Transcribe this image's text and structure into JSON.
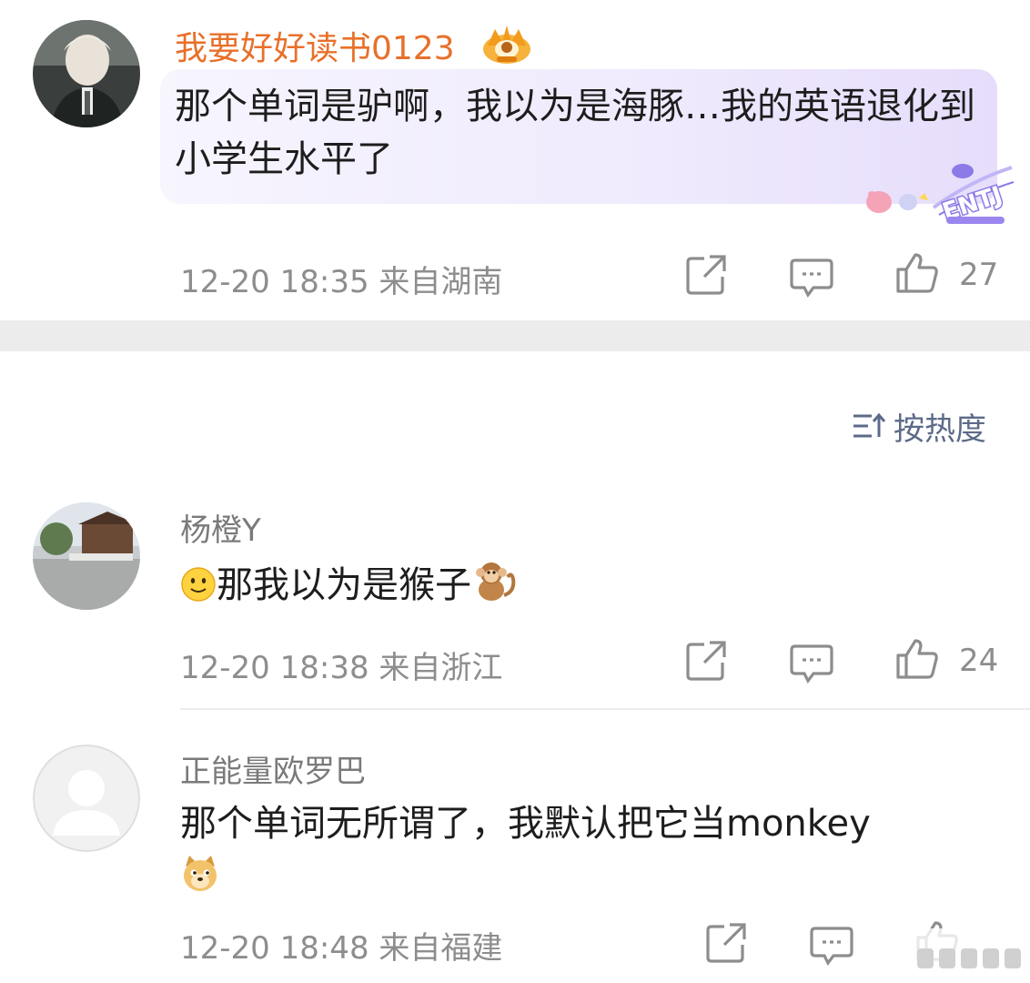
{
  "top_comment": {
    "username": "我要好好读书0123",
    "text": "那个单词是驴啊，我以为是海豚…我的英语退化到小学生水平了",
    "timestamp": "12-20 18:35",
    "location": "来自湖南",
    "likes": "27",
    "badge_icon": "crown-badge-icon",
    "sticker_text": "ENTJ"
  },
  "sort": {
    "label": "按热度",
    "icon": "sort-icon"
  },
  "replies": [
    {
      "username": "杨橙Y",
      "text": "那我以为是猴子",
      "timestamp": "12-20 18:38",
      "location": "来自浙江",
      "likes": "24"
    },
    {
      "username": "正能量欧罗巴",
      "text": "那个单词无所谓了，我默认把它当monkey",
      "timestamp": "12-20 18:48",
      "location": "来自福建",
      "likes": ""
    }
  ],
  "colors": {
    "username_highlight": "#e8702a",
    "meta_text": "#8d8d8d",
    "sort_text": "#5d6a88",
    "bubble": "#efeafd"
  }
}
